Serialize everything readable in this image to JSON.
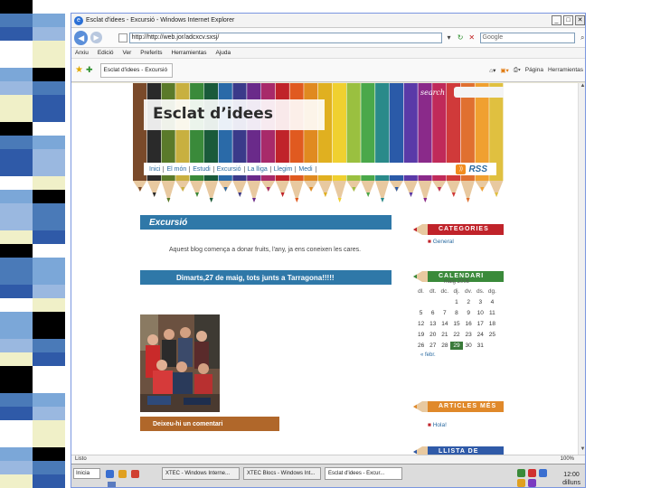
{
  "window": {
    "title": "Esclat d'idees - Excursió - Windows Internet Explorer",
    "minimize": "_",
    "maximize": "□",
    "close": "✕"
  },
  "address": {
    "url": "http://http://web.jor/adcxcv.sxsj/",
    "search_placeholder": "Google"
  },
  "menu": [
    "Arxiu",
    "Edició",
    "Ver",
    "Preferits",
    "Herramientas",
    "Ajuda"
  ],
  "tab": {
    "label": "Esclat d'idees - Excursió"
  },
  "command_bar": [
    "Página",
    "Herramientas"
  ],
  "site": {
    "title": "Esclat d’idees",
    "search_label": "search",
    "nav": [
      "Inici",
      "El món",
      "Estudi",
      "Excursió",
      "La lliga",
      "Llegim",
      "Medi"
    ],
    "rss": "RSS",
    "section_title": "Excursió",
    "intro": "Aquest blog comença a donar fruits, l'any, ja ens coneixen les cares.",
    "post_title": "Dimarts,27 de maig, tots junts a Tarragona!!!!!",
    "comment_heading": "Deixeu-hi un comentari"
  },
  "sidebar": {
    "categories_label": "CATEGORIES",
    "category_link": "General",
    "calendar_label": "CALENDARI",
    "calendar_month": "maig 2008",
    "calendar_days": [
      "dl.",
      "dt.",
      "dc.",
      "dj.",
      "dv.",
      "ds.",
      "dg."
    ],
    "calendar_rows": [
      [
        "",
        "",
        "",
        "1",
        "2",
        "3",
        "4"
      ],
      [
        "5",
        "6",
        "7",
        "8",
        "9",
        "10",
        "11"
      ],
      [
        "12",
        "13",
        "14",
        "15",
        "16",
        "17",
        "18"
      ],
      [
        "19",
        "20",
        "21",
        "22",
        "23",
        "24",
        "25"
      ],
      [
        "26",
        "27",
        "28",
        "29",
        "30",
        "31",
        ""
      ]
    ],
    "calendar_highlight": "29",
    "calendar_prev": "« febr.",
    "articles_label": "ARTICLES MÉS",
    "articles_link": "Hola!",
    "blogs_label": "LLISTA DE BLOCS"
  },
  "status": {
    "text": "Listo",
    "zoom": "100%"
  },
  "taskbar": {
    "start": "Inicia",
    "tasks": [
      "XTEC - Windows Interne...",
      "XTEC Blocs - Windows Int...",
      "Esclat d'idees - Excur..."
    ],
    "clock": "12:00",
    "clock_day": "dilluns"
  },
  "colors": {
    "blue_bar": "#2f78a8",
    "brown_bar": "#b0672a",
    "red_head": "#c0232a",
    "green_head": "#3a8a3a",
    "orange_head": "#e0892a"
  }
}
